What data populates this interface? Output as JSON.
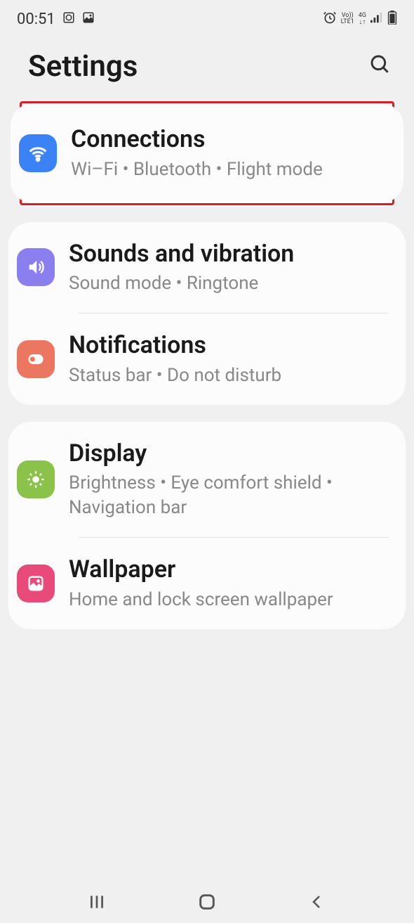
{
  "status_bar": {
    "time": "00:51",
    "network": "4G",
    "lte": "LTE1",
    "vo": "Vo))"
  },
  "header": {
    "title": "Settings"
  },
  "groups": [
    {
      "highlighted": true,
      "items": [
        {
          "title": "Connections",
          "subtitle": "Wi–Fi  •  Bluetooth  •  Flight mode",
          "icon": "wifi",
          "color": "blue"
        }
      ]
    },
    {
      "highlighted": false,
      "items": [
        {
          "title": "Sounds and vibration",
          "subtitle": "Sound mode  •  Ringtone",
          "icon": "sound",
          "color": "purple"
        },
        {
          "title": "Notifications",
          "subtitle": "Status bar  •  Do not disturb",
          "icon": "notif",
          "color": "coral"
        }
      ]
    },
    {
      "highlighted": false,
      "items": [
        {
          "title": "Display",
          "subtitle": "Brightness  •  Eye comfort shield  •  Navigation bar",
          "icon": "brightness",
          "color": "green"
        },
        {
          "title": "Wallpaper",
          "subtitle": "Home and lock screen wallpaper",
          "icon": "wallpaper",
          "color": "pink"
        }
      ]
    }
  ]
}
